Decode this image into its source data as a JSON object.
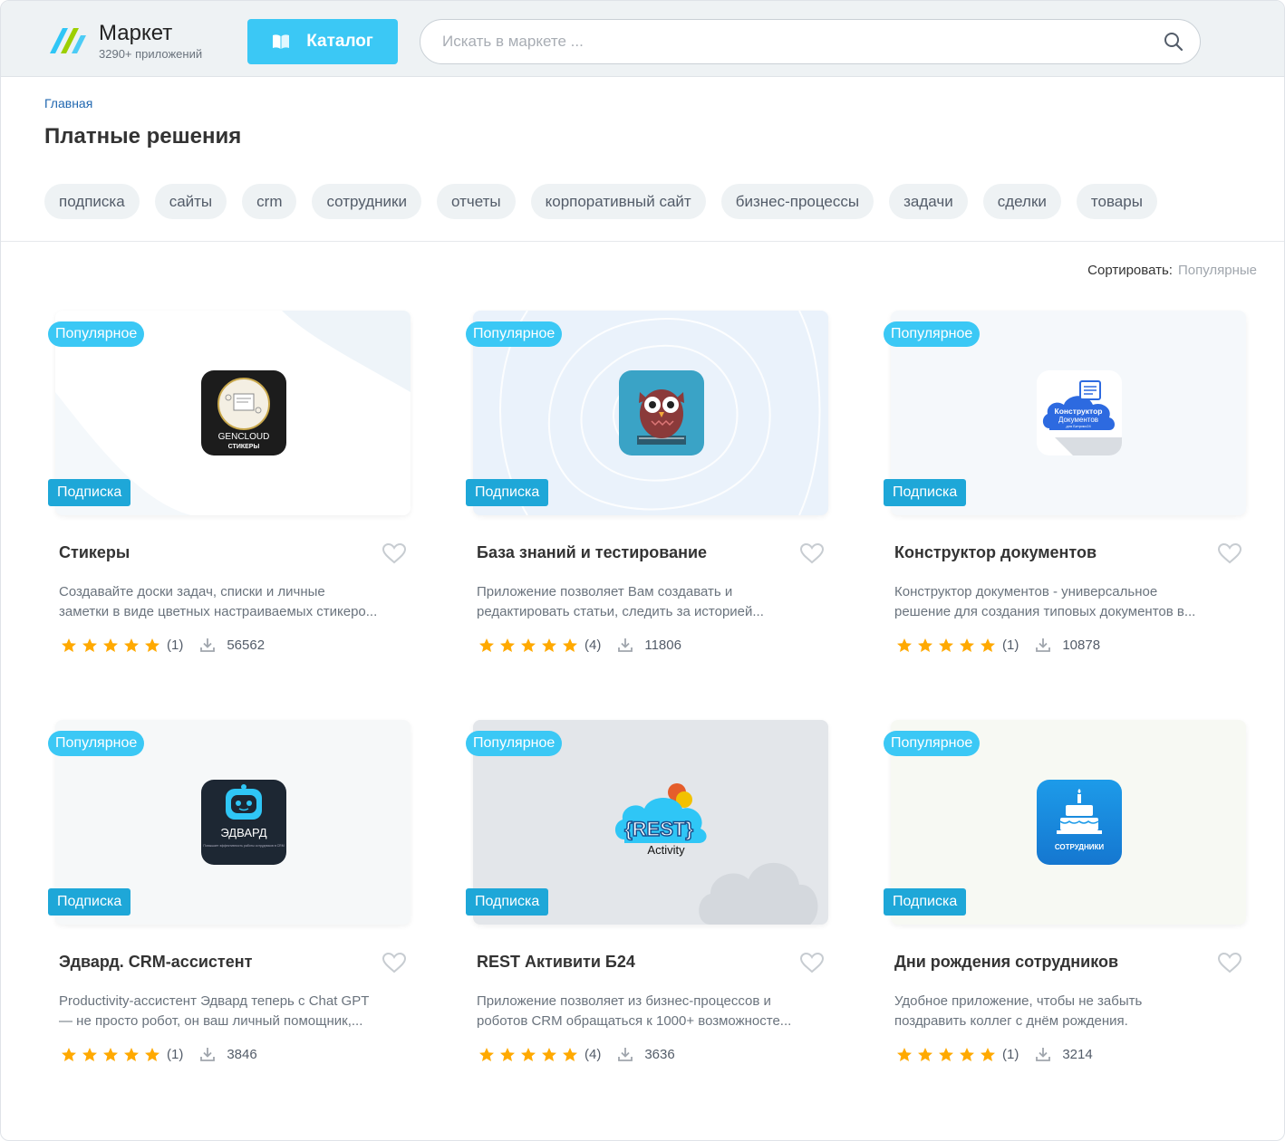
{
  "header": {
    "logo_title": "Маркет",
    "logo_subtitle": "3290+ приложений",
    "catalog_label": "Каталог",
    "search_placeholder": "Искать в маркете ..."
  },
  "breadcrumb": "Главная",
  "page_title": "Платные решения",
  "tags": [
    "подписка",
    "сайты",
    "crm",
    "сотрудники",
    "отчеты",
    "корпоративный сайт",
    "бизнес-процессы",
    "задачи",
    "сделки",
    "товары"
  ],
  "sort": {
    "label": "Сортировать:",
    "value": "Популярные"
  },
  "colors": {
    "accent": "#3bc8f5",
    "subscription_badge": "#1ea7d8",
    "star": "#ffa900",
    "link": "#2067b0"
  },
  "cards": [
    {
      "badge_popular": "Популярное",
      "badge_subscription": "Подписка",
      "title": "Стикеры",
      "desc_line1": "Создавайте доски задач, списки и личные",
      "desc_line2": "заметки в виде цветных настраиваемых стикеро...",
      "rating": 5,
      "reviews": "(1)",
      "installs": "56562",
      "icon_name": "gencloud-stickers-icon",
      "icon_text_1": "GENCLOUD",
      "icon_text_2": "СТИКЕРЫ"
    },
    {
      "badge_popular": "Популярное",
      "badge_subscription": "Подписка",
      "title": "База знаний и тестирование",
      "desc_line1": "Приложение позволяет Вам создавать и",
      "desc_line2": "редактировать статьи, следить за историей...",
      "rating": 5,
      "reviews": "(4)",
      "installs": "11806",
      "icon_name": "owl-icon"
    },
    {
      "badge_popular": "Популярное",
      "badge_subscription": "Подписка",
      "title": "Конструктор документов",
      "desc_line1": "Конструктор документов - универсальное",
      "desc_line2": "решение для создания типовых документов в...",
      "rating": 5,
      "reviews": "(1)",
      "installs": "10878",
      "icon_name": "document-cloud-icon",
      "icon_text_1": "Конструктор",
      "icon_text_2": "Документов",
      "icon_text_3": "для Битрикс24"
    },
    {
      "badge_popular": "Популярное",
      "badge_subscription": "Подписка",
      "title": "Эдвард. CRM-ассистент",
      "desc_line1": "Productivity-ассистент Эдвард теперь с Chat GPT",
      "desc_line2": "— не просто робот, он ваш личный помощник,...",
      "rating": 5,
      "reviews": "(1)",
      "installs": "3846",
      "icon_name": "robot-icon",
      "icon_text_1": "ЭДВАРД",
      "icon_text_2": "Повышает эффективность работы сотрудников в CRM"
    },
    {
      "badge_popular": "Популярное",
      "badge_subscription": "Подписка",
      "title": "REST Активити Б24",
      "desc_line1": "Приложение позволяет из бизнес-процессов и",
      "desc_line2": "роботов CRM обращаться к 1000+ возможносте...",
      "rating": 5,
      "reviews": "(4)",
      "installs": "3636",
      "icon_name": "rest-activity-icon",
      "icon_text_1": "{REST}",
      "icon_text_2": "Activity"
    },
    {
      "badge_popular": "Популярное",
      "badge_subscription": "Подписка",
      "title": "Дни рождения сотрудников",
      "desc_line1": "Удобное приложение, чтобы не забыть",
      "desc_line2": "поздравить коллег с днём рождения.",
      "rating": 5,
      "reviews": "(1)",
      "installs": "3214",
      "icon_name": "birthday-cake-icon",
      "icon_text_1": "СОТРУДНИКИ"
    }
  ]
}
